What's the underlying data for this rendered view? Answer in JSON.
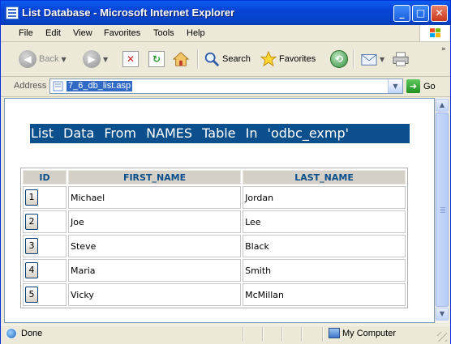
{
  "window": {
    "title": "List Database - Microsoft Internet Explorer"
  },
  "menu": [
    "File",
    "Edit",
    "View",
    "Favorites",
    "Tools",
    "Help"
  ],
  "toolbar": {
    "back": "Back",
    "search": "Search",
    "favorites": "Favorites"
  },
  "address": {
    "label": "Address",
    "value": "7_6_db_list.asp",
    "go": "Go"
  },
  "page": {
    "heading": "List Data From NAMES Table In 'odbc_exmp'",
    "columns": [
      "ID",
      "FIRST_NAME",
      "LAST_NAME"
    ],
    "rows": [
      {
        "id": "1",
        "first": "Michael",
        "last": "Jordan"
      },
      {
        "id": "2",
        "first": "Joe",
        "last": "Lee"
      },
      {
        "id": "3",
        "first": "Steve",
        "last": "Black"
      },
      {
        "id": "4",
        "first": "Maria",
        "last": "Smith"
      },
      {
        "id": "5",
        "first": "Vicky",
        "last": "McMillan"
      }
    ]
  },
  "status": {
    "text": "Done",
    "zone": "My Computer"
  },
  "colors": {
    "titlebar": "#0a5ef0",
    "heading_bg": "#0b4f8c",
    "header_text": "#0b4f8c"
  }
}
